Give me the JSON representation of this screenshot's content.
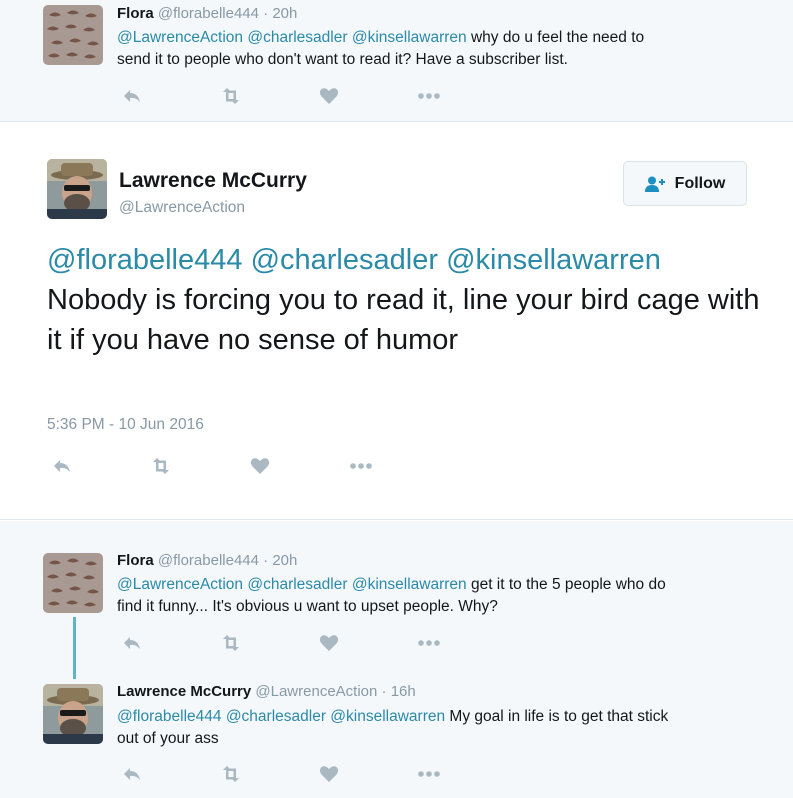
{
  "reply_top": {
    "name": "Flora",
    "handle": "@florabelle444",
    "time": "· 20h",
    "mentions": [
      "@LawrenceAction",
      "@charlesadler",
      "@kinsellawarren"
    ],
    "text_line1_rest": " why do u feel the need to",
    "text_line2": "send it to people who don't want to read it? Have a subscriber list."
  },
  "main_tweet": {
    "name": "Lawrence McCurry",
    "handle": "@LawrenceAction",
    "follow_label": "Follow",
    "mention1": "@florabelle444",
    "mention2": "@charlesadler",
    "mention3": "@kinsellawarren",
    "text_rest": " Nobody is forcing you to read it, line your bird cage with it if you have no sense of humor",
    "timestamp": "5:36 PM - 10 Jun 2016"
  },
  "reply_bottom_1": {
    "name": "Flora",
    "handle": "@florabelle444",
    "time": "· 20h",
    "mentions": [
      "@LawrenceAction",
      "@charlesadler",
      "@kinsellawarren"
    ],
    "text_line1_rest": " get it to the 5 people who do",
    "text_line2": "find it funny... It's obvious u want to upset people. Why?"
  },
  "reply_bottom_2": {
    "name": "Lawrence McCurry",
    "handle": "@LawrenceAction",
    "time": "· 16h",
    "mentions": [
      "@florabelle444",
      "@charlesadler",
      "@kinsellawarren"
    ],
    "text_line1_rest": " My goal in life is to get that stick",
    "text_line2": "out of your ass"
  },
  "icons": [
    "reply-icon",
    "retweet-icon",
    "like-icon",
    "more-icon",
    "follow-person-icon"
  ],
  "colors": {
    "link": "#2a8aa8",
    "muted": "#8899a6",
    "icon": "#aab8c2",
    "bg_reply": "#f5f8fa"
  }
}
